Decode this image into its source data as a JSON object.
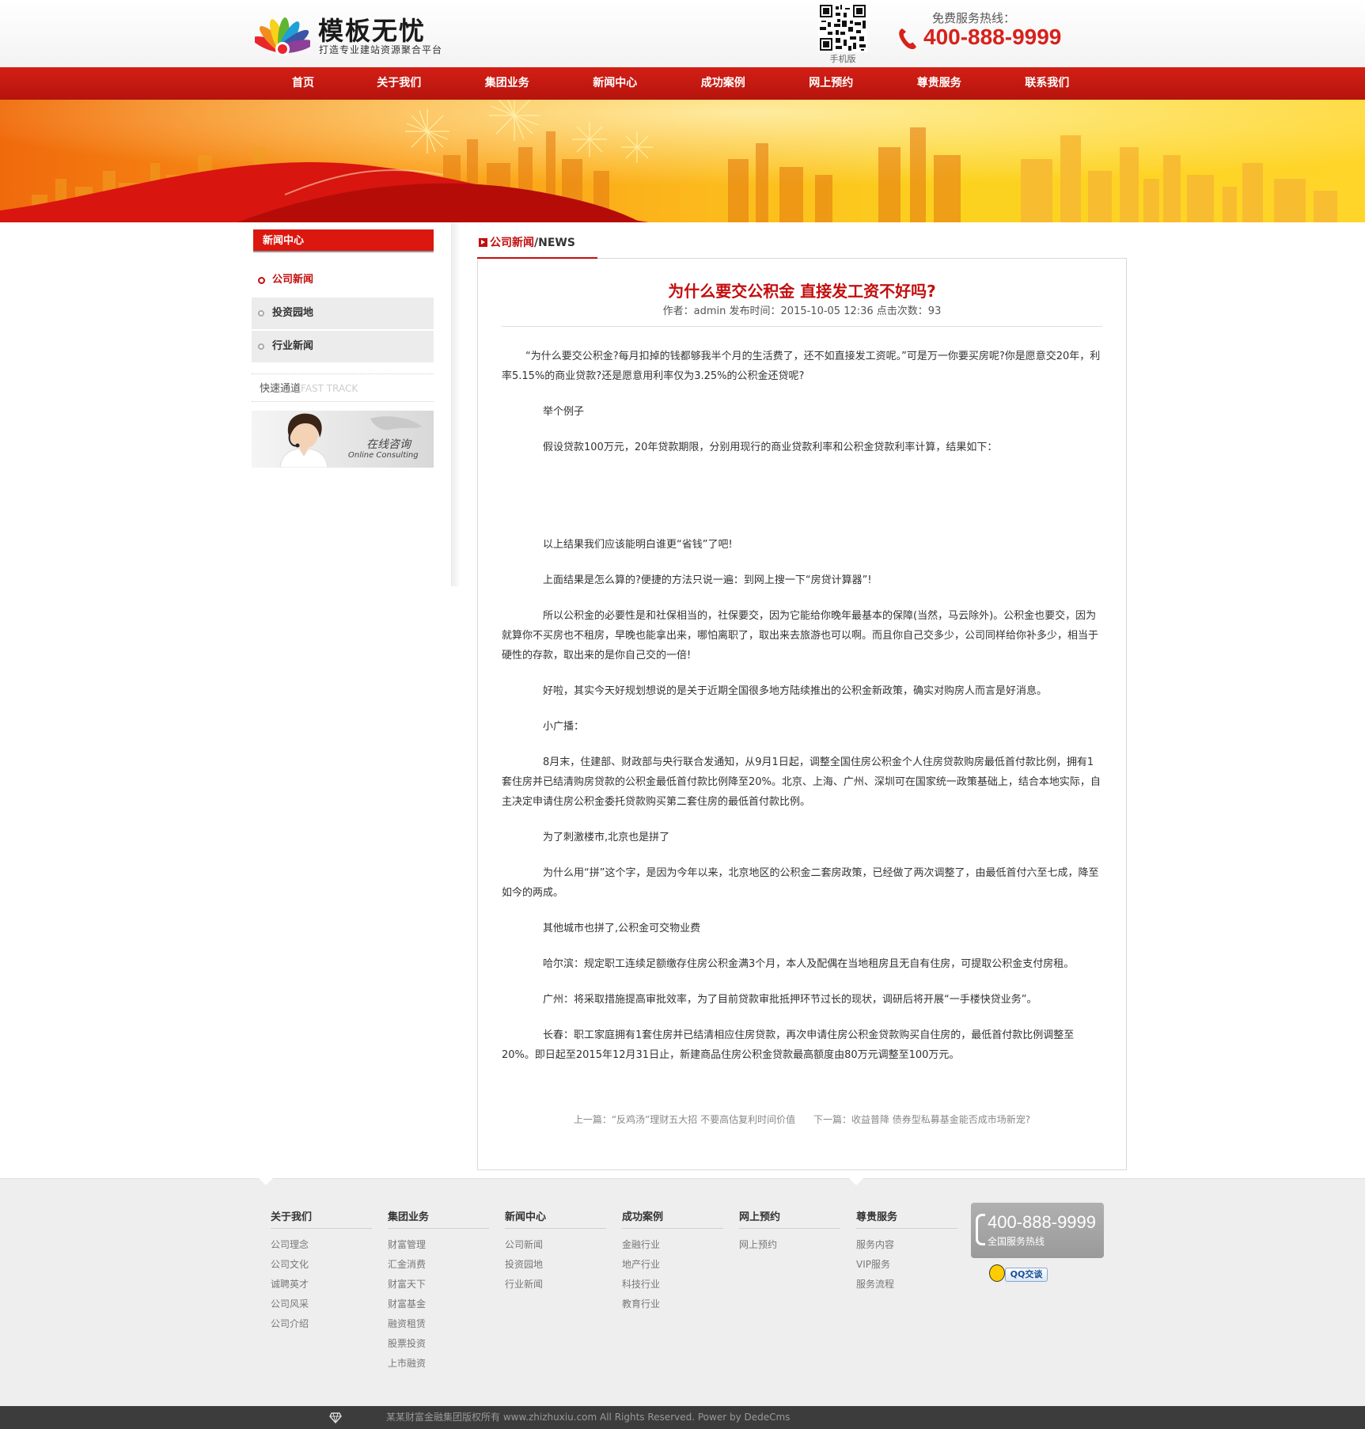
{
  "header": {
    "logo_title": "模板无忧",
    "logo_slogan": "打造专业建站资源聚合平台",
    "qr_label": "手机版",
    "hotline_label": "免费服务热线：",
    "hotline_number": "400-888-9999"
  },
  "nav": {
    "items": [
      "首页",
      "关于我们",
      "集团业务",
      "新闻中心",
      "成功案例",
      "网上预约",
      "尊贵服务",
      "联系我们"
    ]
  },
  "sidebar": {
    "title": "新闻中心",
    "items": [
      {
        "label": "公司新闻",
        "active": true
      },
      {
        "label": "投资园地",
        "active": false
      },
      {
        "label": "行业新闻",
        "active": false
      }
    ],
    "fast_track_cn": "快速通道",
    "fast_track_en": "FAST TRACK",
    "consult_cn": "在线咨询",
    "consult_en": "Online Consulting"
  },
  "main": {
    "tab_cn": "公司新闻",
    "tab_en": "/NEWS",
    "title": "为什么要交公积金 直接发工资不好吗?",
    "meta": "作者：admin 发布时间：2015-10-05 12:36 点击次数：93",
    "paragraphs": [
      "“为什么要交公积金?每月扣掉的钱都够我半个月的生活费了，还不如直接发工资呢。”可是万一你要买房呢?你是愿意交20年，利率5.15%的商业贷款?还是愿意用利率仅为3.25%的公积金还贷呢?",
      "举个例子",
      "假设贷款100万元，20年贷款期限，分别用现行的商业贷款利率和公积金贷款利率计算，结果如下：",
      "",
      "以上结果我们应该能明白谁更“省钱”了吧!",
      "上面结果是怎么算的?便捷的方法只说一遍：到网上搜一下“房贷计算器”!",
      "所以公积金的必要性是和社保相当的，社保要交，因为它能给你晚年最基本的保障(当然，马云除外)。公积金也要交，因为就算你不买房也不租房，早晚也能拿出来，哪怕离职了，取出来去旅游也可以啊。而且你自己交多少，公司同样给你补多少，相当于硬性的存款，取出来的是你自己交的一倍!",
      "好啦，其实今天好规划想说的是关于近期全国很多地方陆续推出的公积金新政策，确实对购房人而言是好消息。",
      "小广播：",
      "8月末，住建部、财政部与央行联合发通知，从9月1日起，调整全国住房公积金个人住房贷款购房最低首付款比例，拥有1套住房并已结清购房贷款的公积金最低首付款比例降至20%。北京、上海、广州、深圳可在国家统一政策基础上，结合本地实际，自主决定申请住房公积金委托贷款购买第二套住房的最低首付款比例。",
      "为了刺激楼市,北京也是拼了",
      "为什么用“拼”这个字，是因为今年以来，北京地区的公积金二套房政策，已经做了两次调整了，由最低首付六至七成，降至如今的两成。",
      "其他城市也拼了,公积金可交物业费",
      "哈尔滨：规定职工连续足额缴存住房公积金满3个月，本人及配偶在当地租房且无自有住房，可提取公积金支付房租。",
      "广州：将采取措施提高审批效率，为了目前贷款审批抵押环节过长的现状，调研后将开展“一手楼快贷业务”。",
      "长春：职工家庭拥有1套住房并已结清相应住房贷款，再次申请住房公积金贷款购买自住房的，最低首付款比例调整至20%。即日起至2015年12月31日止，新建商品住房公积金贷款最高额度由80万元调整至100万元。"
    ],
    "prev": "上一篇：“反鸡汤”理财五大招 不要高估复利时间价值",
    "next": "下一篇：收益普降 债券型私募基金能否成市场新宠?"
  },
  "footer": {
    "columns": [
      {
        "title": "关于我们",
        "links": [
          "公司理念",
          "公司文化",
          "诚聘英才",
          "公司风采",
          "公司介绍"
        ]
      },
      {
        "title": "集团业务",
        "links": [
          "财富管理",
          "汇金消费",
          "财富天下",
          "财富基金",
          "融资租赁",
          "股票投资",
          "上市融资"
        ]
      },
      {
        "title": "新闻中心",
        "links": [
          "公司新闻",
          "投资园地",
          "行业新闻"
        ]
      },
      {
        "title": "成功案例",
        "links": [
          "金融行业",
          "地产行业",
          "科技行业",
          "教育行业"
        ]
      },
      {
        "title": "网上预约",
        "links": [
          "网上预约"
        ]
      },
      {
        "title": "尊贵服务",
        "links": [
          "服务内容",
          "VIP服务",
          "服务流程"
        ]
      }
    ],
    "phone_number": "400-888-9999",
    "phone_label": "全国服务热线",
    "qq_label": "QQ交谈",
    "copyright": "某某财富金融集团版权所有 www.zhizhuxiu.com All Rights Reserved. Power by DedeCms"
  },
  "colors": {
    "brand_red": "#c40e0e",
    "nav_red": "#c8180f",
    "banner_orange": "#f5871a",
    "banner_yellow": "#fcd21f"
  }
}
